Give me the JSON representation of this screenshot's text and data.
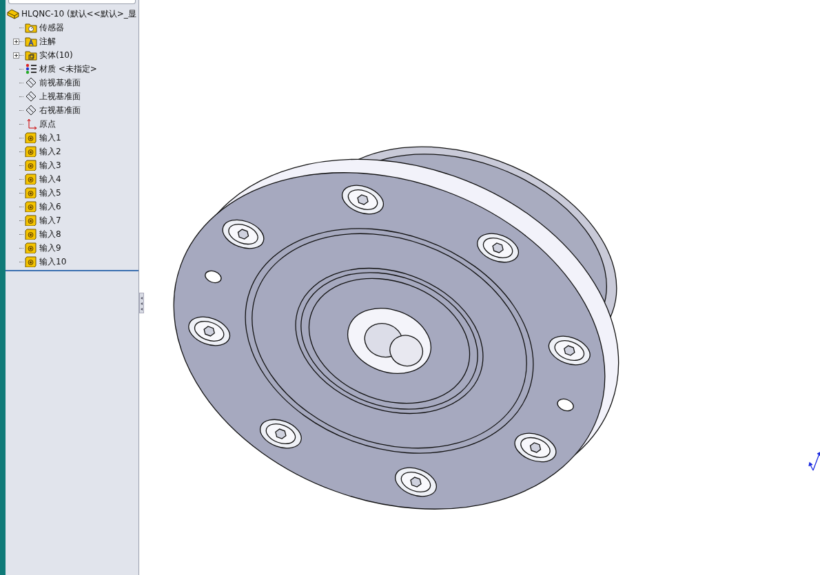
{
  "tree": {
    "root": {
      "label": "HLQNC-10  (默认<<默认>_显"
    },
    "items": [
      {
        "kind": "sensor",
        "label": "传感器",
        "expandable": false
      },
      {
        "kind": "annotation",
        "label": "注解",
        "expandable": true
      },
      {
        "kind": "solid",
        "label": "实体(10)",
        "expandable": true
      },
      {
        "kind": "material",
        "label": "材质 <未指定>",
        "expandable": false
      },
      {
        "kind": "plane",
        "label": "前视基准面",
        "expandable": false
      },
      {
        "kind": "plane",
        "label": "上视基准面",
        "expandable": false
      },
      {
        "kind": "plane",
        "label": "右视基准面",
        "expandable": false
      },
      {
        "kind": "origin",
        "label": "原点",
        "expandable": false
      },
      {
        "kind": "import",
        "label": "输入1",
        "expandable": false
      },
      {
        "kind": "import",
        "label": "输入2",
        "expandable": false
      },
      {
        "kind": "import",
        "label": "输入3",
        "expandable": false
      },
      {
        "kind": "import",
        "label": "输入4",
        "expandable": false
      },
      {
        "kind": "import",
        "label": "输入5",
        "expandable": false
      },
      {
        "kind": "import",
        "label": "输入6",
        "expandable": false
      },
      {
        "kind": "import",
        "label": "输入7",
        "expandable": false
      },
      {
        "kind": "import",
        "label": "输入8",
        "expandable": false
      },
      {
        "kind": "import",
        "label": "输入9",
        "expandable": false
      },
      {
        "kind": "import",
        "label": "输入10",
        "expandable": false
      }
    ]
  }
}
